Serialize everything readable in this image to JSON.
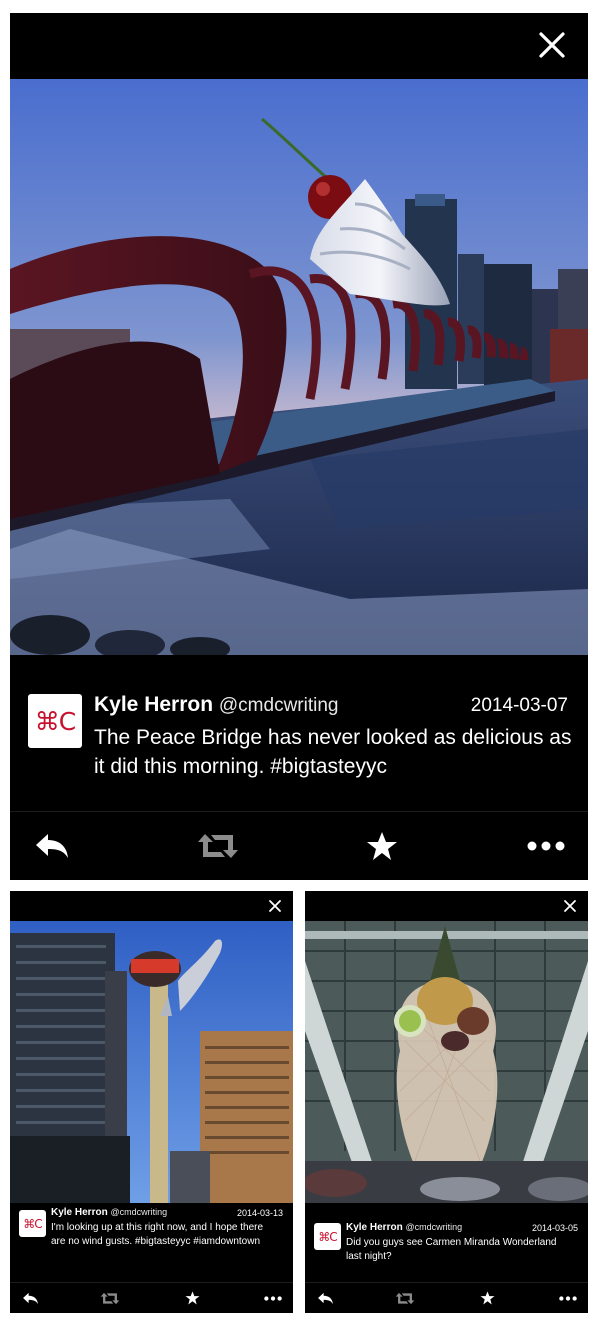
{
  "main": {
    "tweet": {
      "avatar": "⌘C",
      "name": "Kyle Herron",
      "handle": "@cmdcwriting",
      "date": "2014-03-07",
      "text": "The Peace Bridge has never looked as delicious as it did this morning. #bigtasteyyc"
    }
  },
  "left": {
    "tweet": {
      "avatar": "⌘C",
      "name": "Kyle Herron",
      "handle": "@cmdcwriting",
      "date": "2014-03-13",
      "text": "I'm looking up at this right now, and I hope there are no wind gusts. #bigtasteyyc #iamdowntown"
    }
  },
  "right": {
    "tweet": {
      "avatar": "⌘C",
      "name": "Kyle Herron",
      "handle": "@cmdcwriting",
      "date": "2014-03-05",
      "text": "Did you guys see Carmen Miranda Wonderland last night?"
    }
  },
  "icons": {
    "close": "close-icon",
    "reply": "reply-icon",
    "retweet": "retweet-icon",
    "favorite": "star-icon",
    "more": "more-icon"
  },
  "colors": {
    "background": "#000000",
    "avatar_text": "#c8102e",
    "action_active": "#ffffff",
    "action_dim": "#8c8c8c"
  }
}
